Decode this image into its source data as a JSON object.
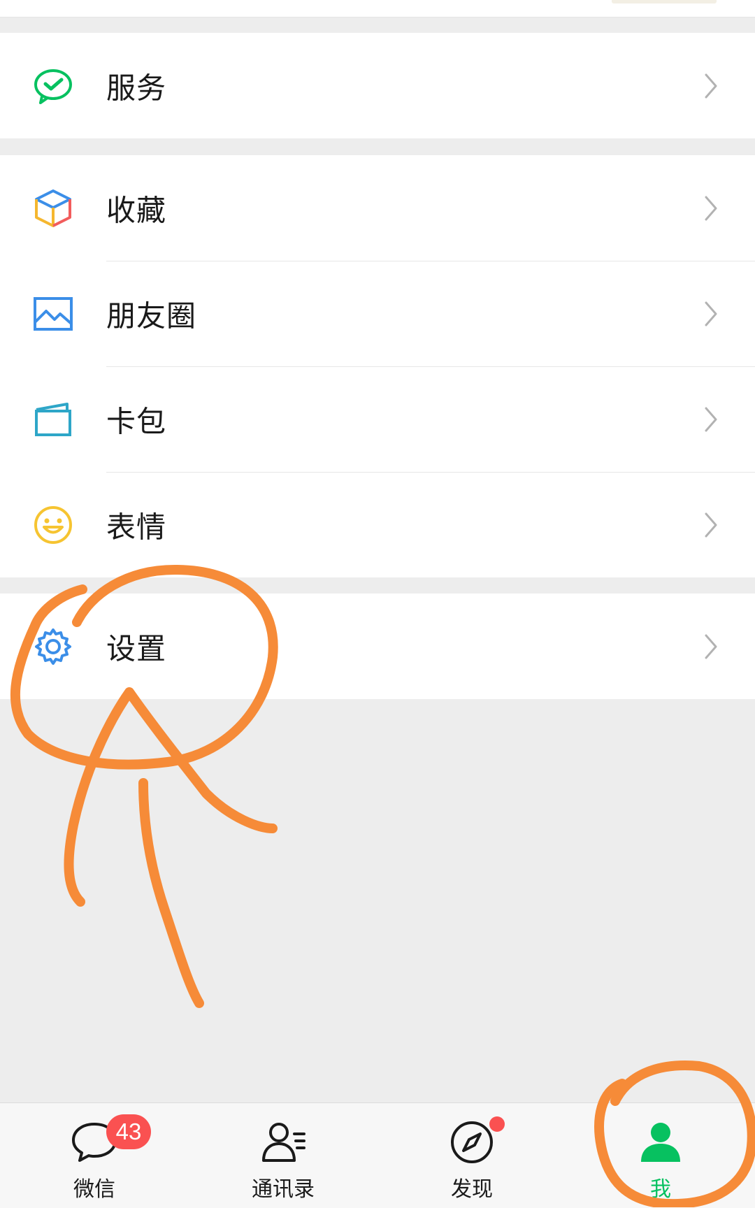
{
  "groups": [
    {
      "items": [
        {
          "label": "服务",
          "icon": "wechat-pay-service-icon"
        }
      ]
    },
    {
      "items": [
        {
          "label": "收藏",
          "icon": "favorites-cube-icon"
        },
        {
          "label": "朋友圈",
          "icon": "moments-picture-icon"
        },
        {
          "label": "卡包",
          "icon": "card-wallet-icon"
        },
        {
          "label": "表情",
          "icon": "sticker-smiley-icon"
        }
      ]
    },
    {
      "items": [
        {
          "label": "设置",
          "icon": "settings-gear-icon"
        }
      ]
    }
  ],
  "tabbar": {
    "tabs": [
      {
        "label": "微信",
        "icon": "chat-bubble-icon",
        "badge": "43"
      },
      {
        "label": "通讯录",
        "icon": "contacts-icon"
      },
      {
        "label": "发现",
        "icon": "discover-compass-icon",
        "dot": true
      },
      {
        "label": "我",
        "icon": "me-person-icon",
        "active": true
      }
    ]
  },
  "colors": {
    "accent_green": "#07c160",
    "badge_red": "#fa5151",
    "annotation_orange": "#f68b38",
    "background": "#ededed"
  }
}
